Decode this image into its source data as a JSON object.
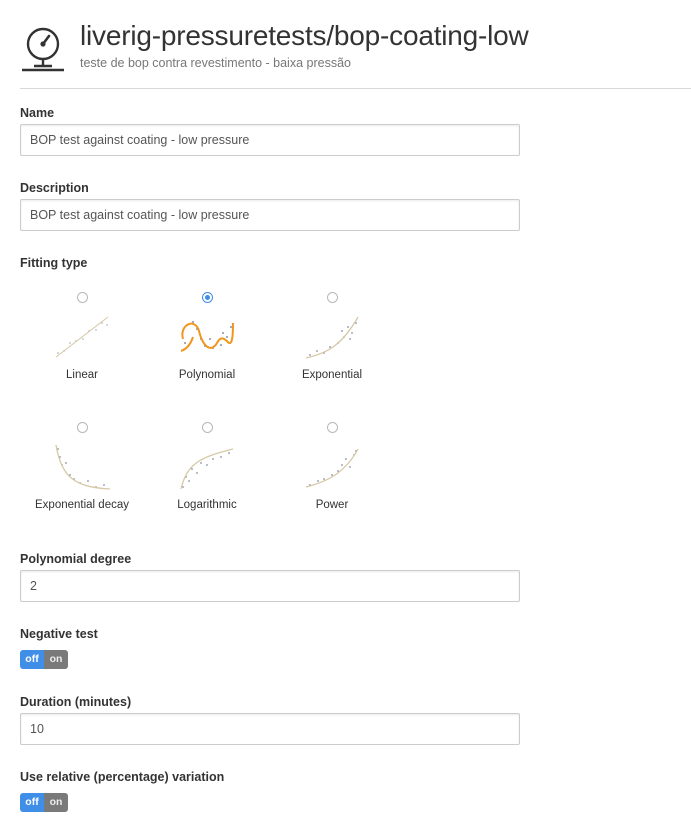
{
  "header": {
    "title": "liverig-pressuretests/bop-coating-low",
    "subtitle": "teste de bop contra revestimento - baixa pressão",
    "logo_icon": "pressure-gauge-icon"
  },
  "form": {
    "name": {
      "label": "Name",
      "value": "BOP test against coating - low pressure"
    },
    "description": {
      "label": "Description",
      "value": "BOP test against coating - low pressure"
    },
    "fitting_type": {
      "label": "Fitting type",
      "selected": "Polynomial",
      "options": [
        {
          "label": "Linear",
          "icon": "linear-fit-icon",
          "checked": false
        },
        {
          "label": "Polynomial",
          "icon": "polynomial-fit-icon",
          "checked": true
        },
        {
          "label": "Exponential",
          "icon": "exponential-fit-icon",
          "checked": false
        },
        {
          "label": "Exponential decay",
          "icon": "exponential-decay-fit-icon",
          "checked": false
        },
        {
          "label": "Logarithmic",
          "icon": "logarithmic-fit-icon",
          "checked": false
        },
        {
          "label": "Power",
          "icon": "power-fit-icon",
          "checked": false
        }
      ]
    },
    "polynomial_degree": {
      "label": "Polynomial degree",
      "value": "2"
    },
    "negative_test": {
      "label": "Negative test",
      "off_label": "off",
      "on_label": "on",
      "state": "off"
    },
    "duration": {
      "label": "Duration (minutes)",
      "value": "10"
    },
    "relative_variation": {
      "label": "Use relative (percentage) variation",
      "off_label": "off",
      "on_label": "on",
      "state": "off"
    }
  },
  "colors": {
    "accent": "#3f8ee8",
    "toggle_off_bg": "#3f8ee8",
    "toggle_on_bg": "#7a7a7a",
    "fit_line_active": "#f0961e",
    "fit_line_inactive": "#d7c9a6",
    "scatter_points": "#8a90a8"
  }
}
